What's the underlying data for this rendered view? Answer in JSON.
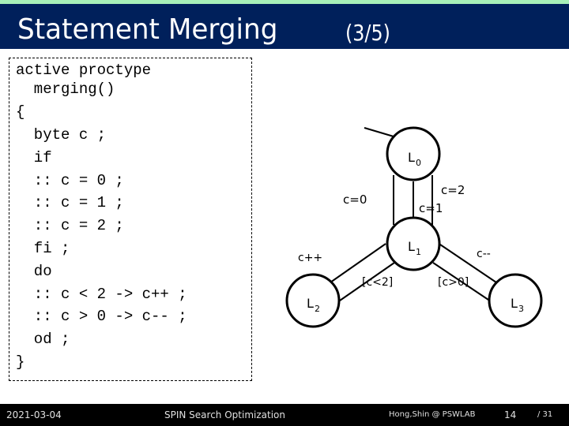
{
  "slide": {
    "title": "Statement Merging",
    "subtitle": "(3/5)",
    "colors": {
      "title_bar": "#00205b",
      "top_band": "#a8f0b8",
      "footer": "#000000"
    }
  },
  "code": {
    "lines": [
      "active proctype",
      "  merging()",
      "{",
      "  byte c ;",
      "  if",
      "  :: c = 0 ;",
      "  :: c = 1 ;",
      "  :: c = 2 ;",
      "  fi ;",
      "  do",
      "  :: c < 2 -> c++ ;",
      "  :: c > 0 -> c-- ;",
      "  od ;",
      "}"
    ]
  },
  "diagram": {
    "nodes": [
      {
        "id": "L0",
        "label": "L",
        "sub": "0"
      },
      {
        "id": "L1",
        "label": "L",
        "sub": "1"
      },
      {
        "id": "L2",
        "label": "L",
        "sub": "2"
      },
      {
        "id": "L3",
        "label": "L",
        "sub": "3"
      }
    ],
    "edge_labels": {
      "c0": "c=0",
      "c1": "c=1",
      "c2": "c=2",
      "cinc": "c++",
      "cdec": "c--",
      "guard_lt": "[c<2]",
      "guard_gt": "[c>0]"
    }
  },
  "footer": {
    "date": "2021-03-04",
    "course": "SPIN Search Optimization",
    "author": "Hong,Shin @ PSWLAB",
    "page": "14",
    "total": "/ 31"
  }
}
